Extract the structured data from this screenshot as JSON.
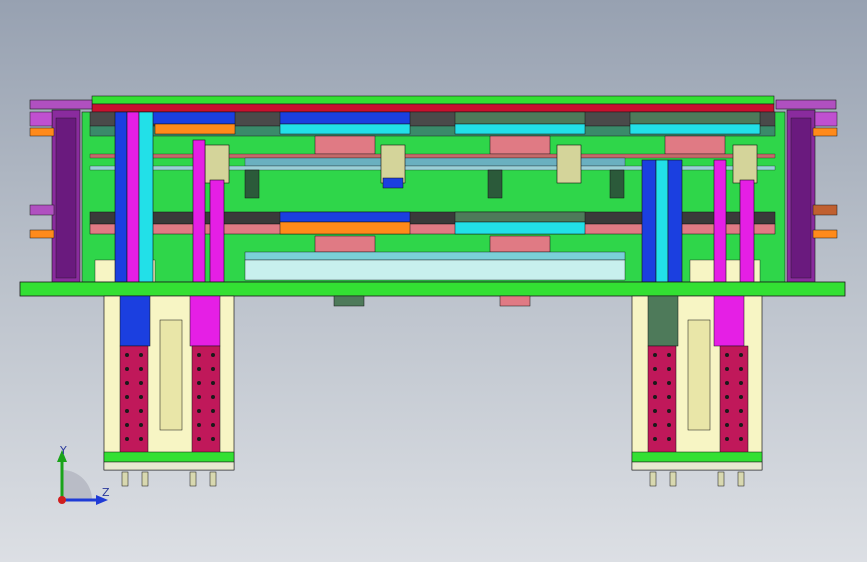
{
  "viewport": {
    "background_top": "#97a1b1",
    "background_bottom": "#dcdfe4"
  },
  "triad": {
    "y_label": "Y",
    "z_label": "Z",
    "y_color": "#1aa31a",
    "z_color": "#1f3bd6",
    "origin_color": "#d01f1f"
  },
  "palette": {
    "green": "#33e033",
    "red": "#c8102e",
    "cyan": "#22e0e8",
    "blue": "#1b3fe0",
    "orange": "#ff8a1a",
    "purple": "#8a2b9e",
    "magenta": "#e51fe5",
    "crimson": "#c0185a",
    "cream": "#f7f5c4",
    "pink": "#e07a84",
    "olive": "#4e7a5a",
    "gray": "#a9a9a9",
    "dark": "#2b2b2b"
  }
}
